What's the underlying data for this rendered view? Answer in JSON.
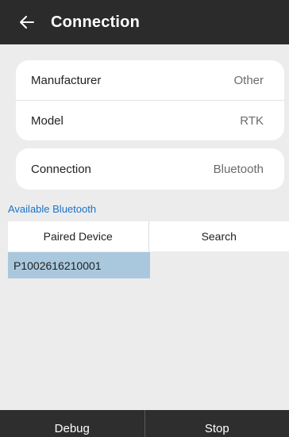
{
  "header": {
    "title": "Connection",
    "back_icon": "arrow-left-icon"
  },
  "device_settings": [
    {
      "label": "Manufacturer",
      "value": "Other"
    },
    {
      "label": "Model",
      "value": "RTK"
    }
  ],
  "connection": {
    "label": "Connection",
    "value": "Bluetooth"
  },
  "bluetooth": {
    "section_label": "Available Bluetooth",
    "tabs": [
      "Paired Device",
      "Search"
    ],
    "devices": [
      "P1002616210001"
    ],
    "selected_color": "#a9c8dd"
  },
  "footer": {
    "debug_label": "Debug",
    "stop_label": "Stop"
  },
  "colors": {
    "topbar": "#2b2b2b",
    "accent": "#1a73c8",
    "background": "#ececec"
  }
}
